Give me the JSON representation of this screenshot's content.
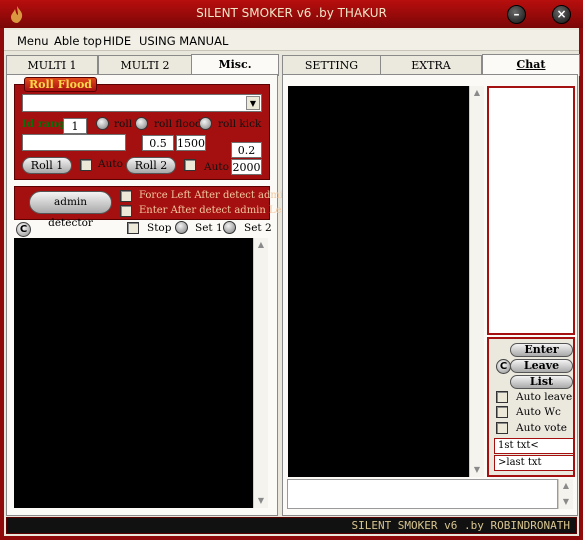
{
  "window": {
    "title": "SILENT SMOKER v6  .by THAKUR"
  },
  "menu": [
    "Menu",
    "Able top",
    "HIDE",
    "USING MANUAL"
  ],
  "left_tabs": [
    "MULTI 1",
    "MULTI 2",
    "Misc."
  ],
  "right_tabs": [
    "SETTING",
    "EXTRA",
    "Chat"
  ],
  "roll_flood": {
    "title": "Roll Flood",
    "id_range_label": "Id range:",
    "id_range_value": "1",
    "radio_labels": [
      "roll",
      "roll flood",
      "roll kick"
    ],
    "value_a": "0.5",
    "value_b": "1500",
    "value_c": "0.2",
    "value_d": "2000",
    "roll1_label": "Roll 1",
    "roll2_label": "Roll 2",
    "auto_label_1": "Auto",
    "auto_label_2": "Auto"
  },
  "admin": {
    "button_label": "admin detector",
    "option1": "Force Left After detect admin",
    "option2": "Enter After detect admin Left"
  },
  "controls": {
    "c_label": "C",
    "stop_label": "Stop",
    "set1_label": "Set 1",
    "set2_label": "Set 2"
  },
  "chat_panel": {
    "enter_label": "Enter",
    "leave_label": "Leave",
    "list_label": "List",
    "c_label": "C",
    "auto_leave": "Auto leave",
    "auto_wc": "Auto Wc",
    "auto_vote": "Auto vote",
    "first_txt": "1st txt<",
    "last_txt": ">last txt"
  },
  "status": {
    "text": "SILENT SMOKER v6  .by ROBINDRONATH"
  },
  "colors": {
    "accent": "#a40f0f",
    "titlebar": "#b80e0e",
    "status_text": "#d8c690"
  }
}
